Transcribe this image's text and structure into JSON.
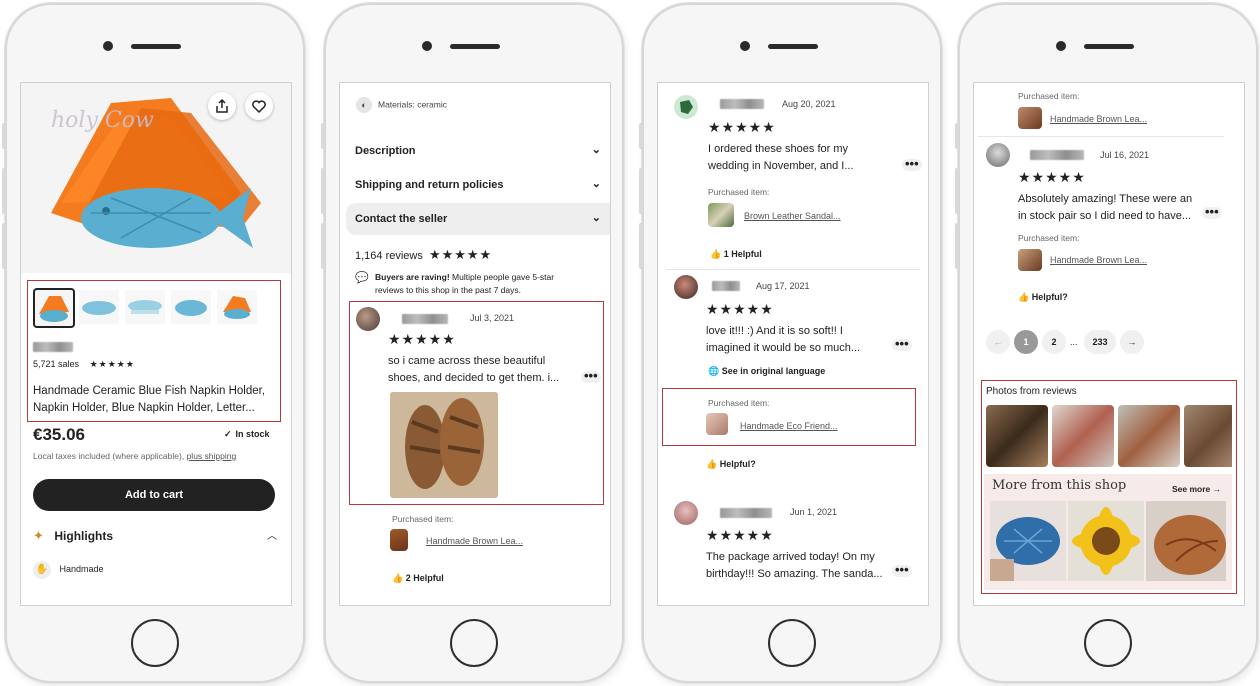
{
  "screen1": {
    "logo_text": "holy Cow",
    "sales": "5,721 sales",
    "title_line1": "Handmade Ceramic Blue Fish Napkin Holder,",
    "title_line2": "Napkin Holder, Blue Napkin Holder, Letter...",
    "price": "€35.06",
    "stock": "In stock",
    "taxes_text": "Local taxes included (where applicable),",
    "shipping_link": "plus shipping",
    "add_to_cart": "Add to cart",
    "highlights": "Highlights",
    "handmade": "Handmade"
  },
  "screen2": {
    "materials": "Materials: ceramic",
    "description": "Description",
    "shipping": "Shipping and return policies",
    "contact": "Contact the seller",
    "reviews_count": "1,164 reviews",
    "raving_bold": "Buyers are raving!",
    "raving_line1": "Multiple people gave 5-star",
    "raving_line2": "reviews to this shop in the past 7 days.",
    "review_date": "Jul 3, 2021",
    "review_line1": "so i came across these beautiful",
    "review_line2": "shoes, and decided to get them. i...",
    "purchased_label": "Purchased item:",
    "purchased_link": "Handmade Brown Lea...",
    "helpful": "2 Helpful"
  },
  "screen3": {
    "r1_date": "Aug 20, 2021",
    "r1_line1": "I ordered these shoes for my",
    "r1_line2": "wedding in November, and I...",
    "r1_purchased_label": "Purchased item:",
    "r1_link": "Brown Leather Sandal...",
    "r1_helpful": "1 Helpful",
    "r2_date": "Aug 17, 2021",
    "r2_line1": "love it!!! :) And it is so soft!! I",
    "r2_line2": "imagined it would be so much...",
    "r2_translate": "See in original language",
    "r2_purchased_label": "Purchased item:",
    "r2_link": "Handmade Eco Friend...",
    "r2_helpful": "Helpful?",
    "r3_date": "Jun 1, 2021",
    "r3_line1": "The package arrived today! On my",
    "r3_line2": "birthday!!! So amazing. The sanda..."
  },
  "screen4": {
    "top_purchased_label": "Purchased item:",
    "top_link": "Handmade Brown Lea...",
    "r_date": "Jul 16, 2021",
    "r_line1": "Absolutely amazing! These were an",
    "r_line2": "in stock pair so I did need to have...",
    "r_purchased_label": "Purchased item:",
    "r_link": "Handmade Brown Lea...",
    "r_helpful": "Helpful?",
    "page1": "1",
    "page2": "2",
    "ellipsis": "...",
    "page_last": "233",
    "photos_title": "Photos from reviews",
    "more_title": "More from this shop",
    "see_more": "See more"
  },
  "stars": "★★★★★",
  "icons": [
    "share-icon",
    "heart-icon",
    "checkmark-icon",
    "sparkle-icon",
    "hand-icon",
    "chevron-down-icon",
    "chevron-up-icon",
    "chat-icon",
    "thumbs-up-icon",
    "globe-icon",
    "arrow-left-icon",
    "arrow-right-icon"
  ]
}
